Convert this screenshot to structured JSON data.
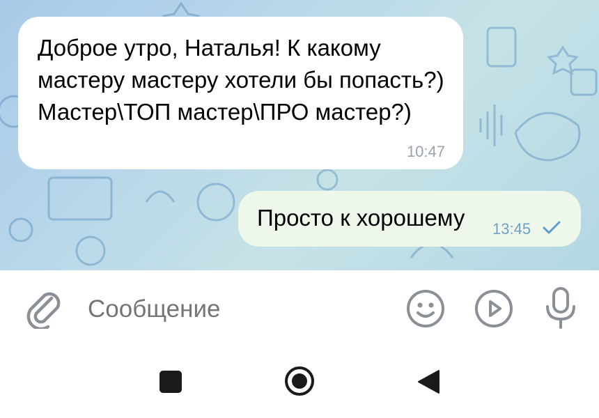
{
  "messages": [
    {
      "direction": "incoming",
      "text": "Доброе утро, Наталья! К какому мастеру мастеру хотели бы попасть?) Мастер\\ТОП мастер\\ПРО мастер?)",
      "time": "10:47"
    },
    {
      "direction": "outgoing",
      "text": "Просто к хорошему",
      "time": "13:45",
      "status": "sent-check"
    }
  ],
  "composer": {
    "placeholder": "Сообщение",
    "icons": [
      "paperclip-icon",
      "emoji-icon",
      "video-message-icon",
      "microphone-icon"
    ]
  },
  "system_nav": {
    "icons": [
      "recents-square-icon",
      "home-circle-icon",
      "back-triangle-icon"
    ]
  },
  "colors": {
    "chat_background": "#b9d8ea",
    "incoming_bubble": "#ffffff",
    "outgoing_bubble": "#eef8ea",
    "outgoing_time": "#6fa0c8",
    "incoming_time": "#9aa3ab",
    "icon_gray": "#8b9097",
    "nav_dark": "#1a1a1a"
  }
}
